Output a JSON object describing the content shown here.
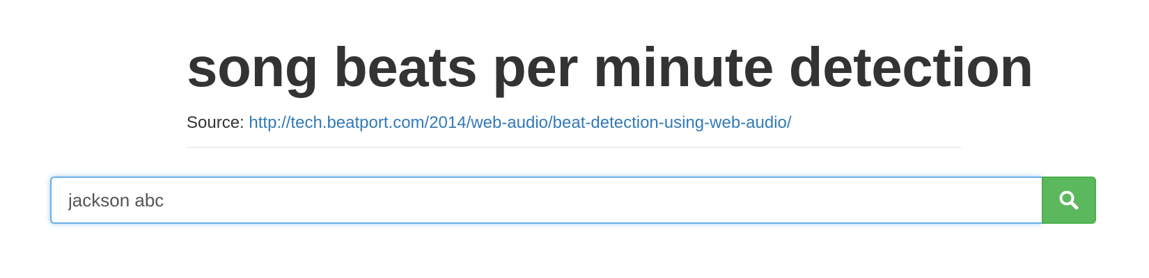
{
  "header": {
    "title": "song beats per minute detection",
    "source_prefix": "Source:",
    "source_link": "http://tech.beatport.com/2014/web-audio/beat-detection-using-web-audio/"
  },
  "search": {
    "value": "jackson abc",
    "button_icon": "search-icon"
  },
  "colors": {
    "link": "#337ab7",
    "search_button": "#5cb85c",
    "input_focus_border": "#66afe9",
    "text": "#333333"
  }
}
